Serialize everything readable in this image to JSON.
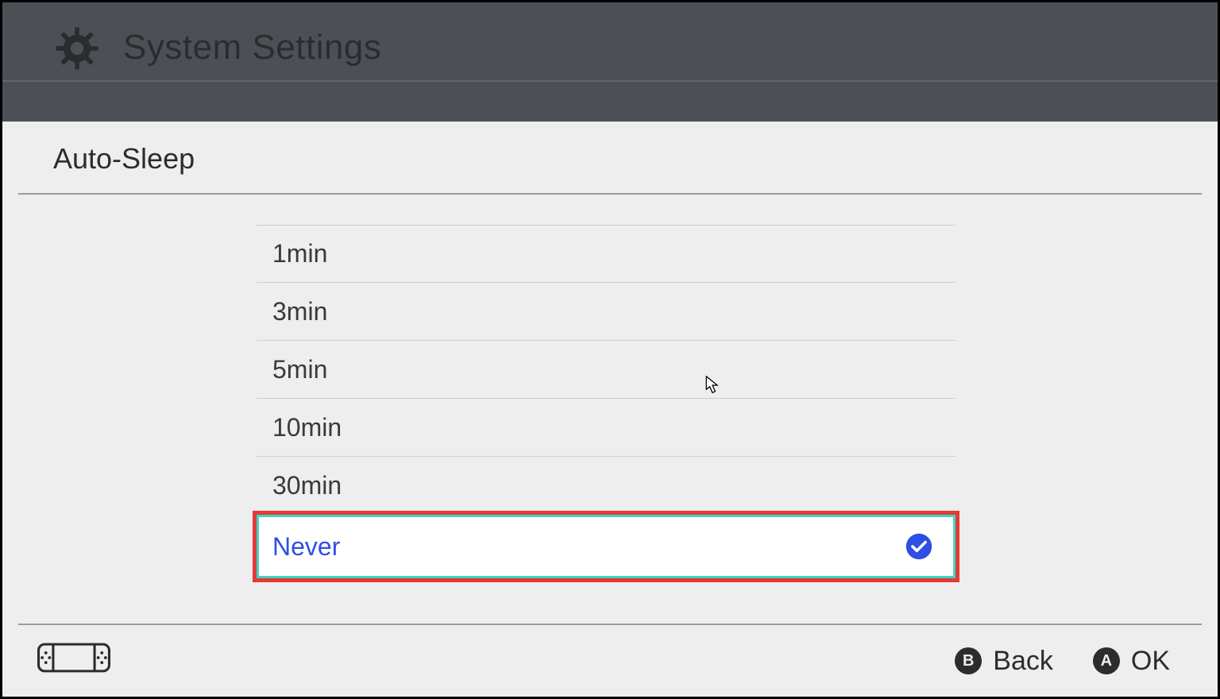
{
  "header": {
    "title": "System Settings"
  },
  "section": {
    "title": "Auto-Sleep"
  },
  "options": [
    {
      "label": "1min",
      "selected": false
    },
    {
      "label": "3min",
      "selected": false
    },
    {
      "label": "5min",
      "selected": false
    },
    {
      "label": "10min",
      "selected": false
    },
    {
      "label": "30min",
      "selected": false
    },
    {
      "label": "Never",
      "selected": true
    }
  ],
  "footer": {
    "back_key": "B",
    "back_label": "Back",
    "ok_key": "A",
    "ok_label": "OK"
  },
  "colors": {
    "accent_blue": "#2f4fe2",
    "highlight_ring": "#3dd6c4",
    "annotation_red": "#e53935",
    "dim_header": "#4c5056",
    "panel_bg": "#eeeeee"
  }
}
